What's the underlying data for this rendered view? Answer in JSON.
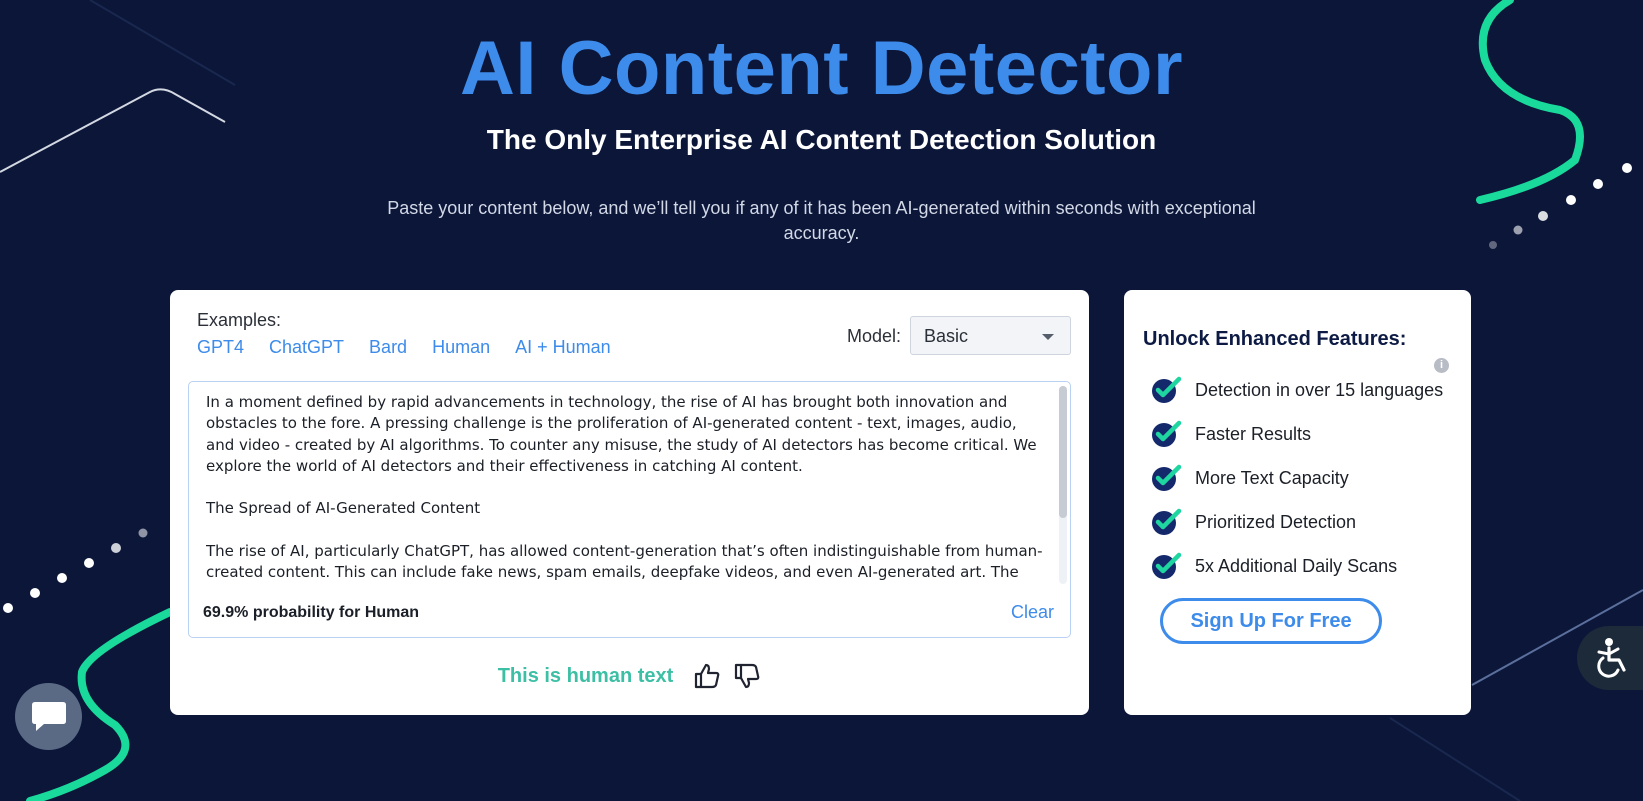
{
  "hero": {
    "title": "AI Content Detector",
    "subtitle": "The Only Enterprise AI Content Detection Solution",
    "description": "Paste your content below, and we’ll tell you if any of it has been AI-generated within seconds with exceptional accuracy."
  },
  "detector": {
    "examples_label": "Examples:",
    "examples": [
      "GPT4",
      "ChatGPT",
      "Bard",
      "Human",
      "AI + Human"
    ],
    "model_label": "Model:",
    "model_selected": "Basic",
    "paragraphs": [
      "In a moment defined by rapid advancements in technology, the rise of AI has brought both innovation and obstacles to the fore. A pressing challenge is the proliferation of AI-generated content - text, images, audio, and video - created by AI algorithms. To counter any misuse, the study of AI detectors has become critical. We explore the world of AI detectors and their effectiveness in catching AI content.",
      "The Spread of AI-Generated Content",
      "The rise of AI, particularly ChatGPT, has allowed content-generation that’s often indistinguishable from human-created content. This can include fake news, spam emails, deepfake videos, and even AI-generated art. The ease"
    ],
    "probability": "69.9% probability for Human",
    "clear_label": "Clear",
    "result_text": "This is human text",
    "thumbs_up_icon": "thumbs-up-icon",
    "thumbs_down_icon": "thumbs-down-icon"
  },
  "features": {
    "title": "Unlock Enhanced Features:",
    "info_icon": "info-icon",
    "items": [
      "Detection in over 15 languages",
      "Faster Results",
      "More Text Capacity",
      "Prioritized Detection",
      "5x Additional Daily Scans"
    ],
    "check_icon": "check-circle-icon",
    "signup_label": "Sign Up For Free"
  },
  "widgets": {
    "chat_icon": "chat-bubble-icon",
    "accessibility_icon": "wheelchair-icon"
  },
  "colors": {
    "background": "#0b1639",
    "accent_blue": "#3d8bea",
    "accent_green": "#1fd6a0",
    "result_teal": "#3cbfa5",
    "check_navy": "#14296b"
  }
}
